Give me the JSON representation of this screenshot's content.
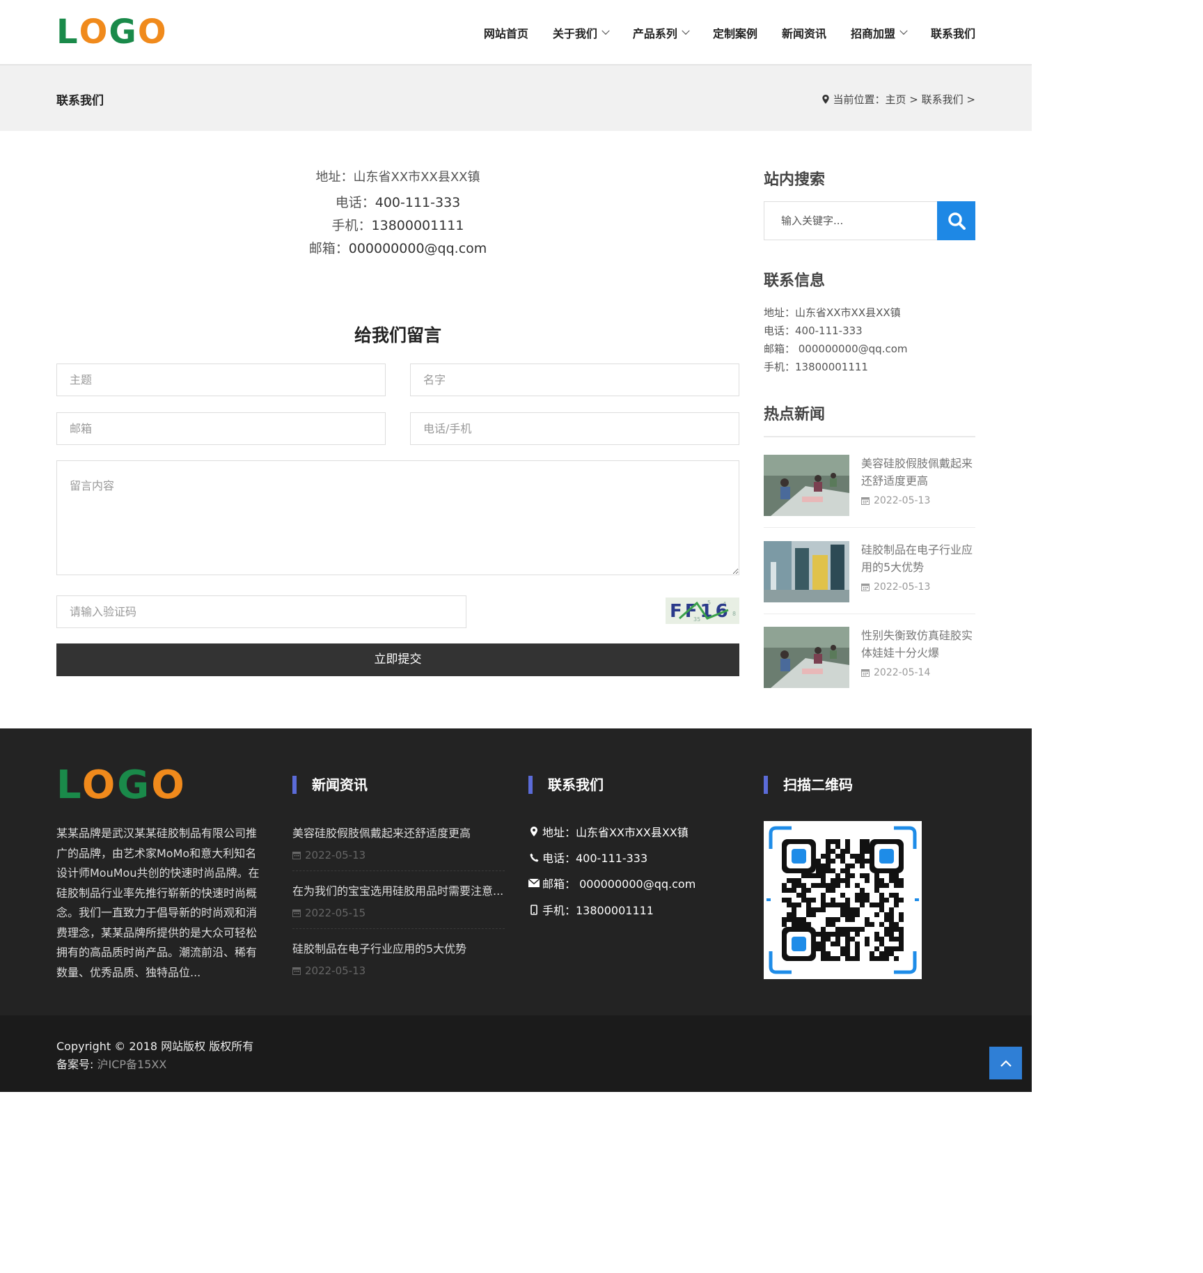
{
  "brand": {
    "logo_letters": [
      "L",
      "O",
      "G",
      "O"
    ],
    "logo_colors": [
      "#1a8a4a",
      "#f08a1c",
      "#1a8a4a",
      "#f08a1c"
    ]
  },
  "nav": [
    {
      "label": "网站首页",
      "dropdown": false
    },
    {
      "label": "关于我们",
      "dropdown": true
    },
    {
      "label": "产品系列",
      "dropdown": true
    },
    {
      "label": "定制案例",
      "dropdown": false
    },
    {
      "label": "新闻资讯",
      "dropdown": false
    },
    {
      "label": "招商加盟",
      "dropdown": true
    },
    {
      "label": "联系我们",
      "dropdown": false
    }
  ],
  "band": {
    "title": "联系我们",
    "breadcrumb_prefix": "当前位置：",
    "crumb_home": "主页",
    "crumb_sep1": " > ",
    "crumb_current": "联系我们",
    "crumb_sep2": " >"
  },
  "contact": {
    "address": "地址：山东省XX市XX县XX镇",
    "phone_label": "电话：",
    "phone": "400-111-333",
    "mobile_label": "手机：",
    "mobile": "13800001111",
    "email_label": "邮箱：",
    "email": "000000000@qq.com"
  },
  "form": {
    "title": "给我们留言",
    "subject_ph": "主题",
    "name_ph": "名字",
    "email_ph": "邮箱",
    "phone_ph": "电话/手机",
    "message_ph": "留言内容",
    "captcha_ph": "请输入验证码",
    "captcha_text": "FF16",
    "submit": "立即提交"
  },
  "sidebar": {
    "search_title": "站内搜索",
    "search_ph": "输入关键字...",
    "info_title": "联系信息",
    "info_lines": [
      "地址：山东省XX市XX县XX镇",
      "电话：400-111-333",
      "邮箱： 000000000@qq.com",
      "手机：13800001111"
    ],
    "hot_title": "热点新闻",
    "hot_news": [
      {
        "title": "美容硅胶假肢佩戴起来还舒适度更高",
        "date": "2022-05-13"
      },
      {
        "title": "硅胶制品在电子行业应用的5大优势",
        "date": "2022-05-13"
      },
      {
        "title": "性别失衡致仿真硅胶实体娃娃十分火爆",
        "date": "2022-05-14"
      }
    ]
  },
  "footer": {
    "desc": "某某品牌是武汉某某硅胶制品有限公司推广的品牌，由艺术家MoMo和意大利知名设计师MouMou共创的快速时尚品牌。在硅胶制品行业率先推行崭新的快速时尚概念。我们一直致力于倡导新的时尚观和消费理念，某某品牌所提供的是大众可轻松拥有的高品质时尚产品。潮流前沿、稀有数量、优秀品质、独特品位...",
    "news_title": "新闻资讯",
    "news": [
      {
        "title": "美容硅胶假肢佩戴起来还舒适度更高",
        "date": "2022-05-13"
      },
      {
        "title": "在为我们的宝宝选用硅胶用品时需要注意...",
        "date": "2022-05-15"
      },
      {
        "title": "硅胶制品在电子行业应用的5大优势",
        "date": "2022-05-13"
      }
    ],
    "contact_title": "联系我们",
    "contact_lines": [
      "地址：山东省XX市XX县XX镇",
      "电话：400-111-333",
      "邮箱： 000000000@qq.com",
      "手机：13800001111"
    ],
    "qr_title": "扫描二维码",
    "copyright": "Copyright © 2018 网站版权 版权所有",
    "icp_label": "备案号: ",
    "icp": "沪ICP备15XX"
  },
  "colors": {
    "accent_blue": "#1e88e5",
    "footer_bar": "#5b6bd8",
    "submit_bg": "#333333"
  }
}
